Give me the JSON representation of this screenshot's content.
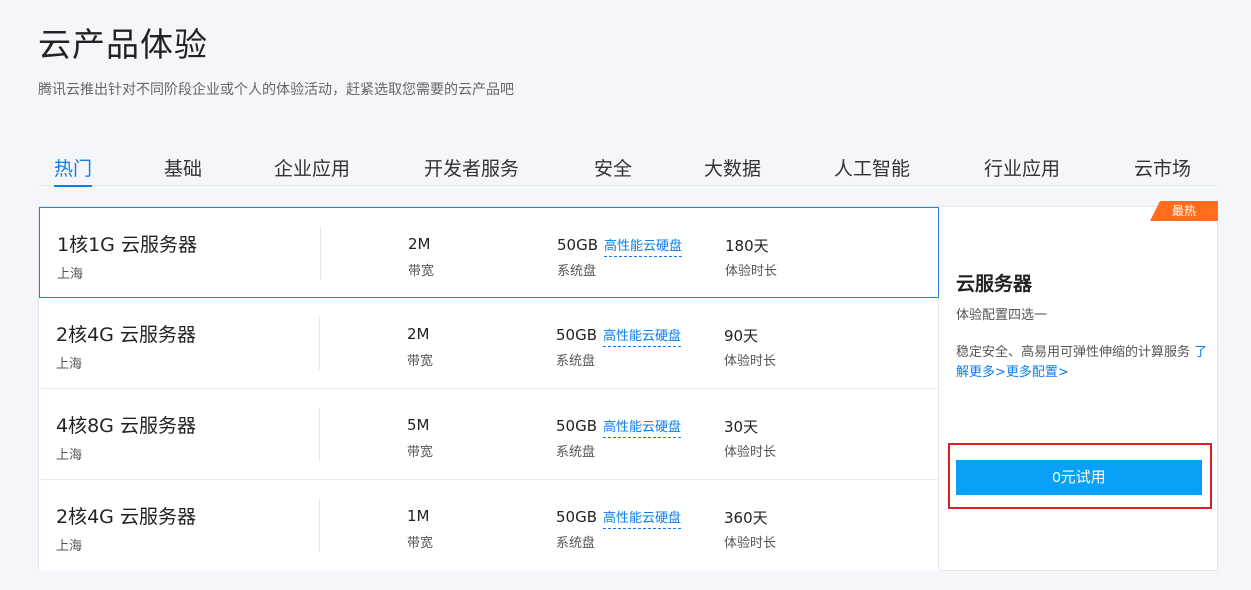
{
  "header": {
    "title": "云产品体验",
    "subtitle": "腾讯云推出针对不同阶段企业或个人的体验活动，赶紧选取您需要的云产品吧"
  },
  "tabs": [
    {
      "label": "热门",
      "active": true
    },
    {
      "label": "基础"
    },
    {
      "label": "企业应用"
    },
    {
      "label": "开发者服务"
    },
    {
      "label": "安全"
    },
    {
      "label": "大数据"
    },
    {
      "label": "人工智能"
    },
    {
      "label": "行业应用"
    },
    {
      "label": "云市场"
    }
  ],
  "labels": {
    "bandwidth": "带宽",
    "system_disk": "系统盘",
    "disk_type": "高性能云硬盘",
    "trial_length": "体验时长"
  },
  "rows": [
    {
      "title": "1核1G 云服务器",
      "region": "上海",
      "bandwidth": "2M",
      "disk": "50GB",
      "duration": "180天",
      "selected": true
    },
    {
      "title": "2核4G 云服务器",
      "region": "上海",
      "bandwidth": "2M",
      "disk": "50GB",
      "duration": "90天"
    },
    {
      "title": "4核8G 云服务器",
      "region": "上海",
      "bandwidth": "5M",
      "disk": "50GB",
      "duration": "30天"
    },
    {
      "title": "2核4G 云服务器",
      "region": "上海",
      "bandwidth": "1M",
      "disk": "50GB",
      "duration": "360天"
    }
  ],
  "side": {
    "badge": "最热",
    "title": "云服务器",
    "subtitle": "体验配置四选一",
    "description": "稳定安全、高易用可弹性伸缩的计算服务",
    "learn_more": "了解更多>",
    "more_config": "更多配置>",
    "button": "0元试用"
  },
  "colors": {
    "accent": "#0a7ef0",
    "button": "#0aa0f5",
    "badge": "#ff6e1f",
    "highlight_outline": "#e02020"
  }
}
